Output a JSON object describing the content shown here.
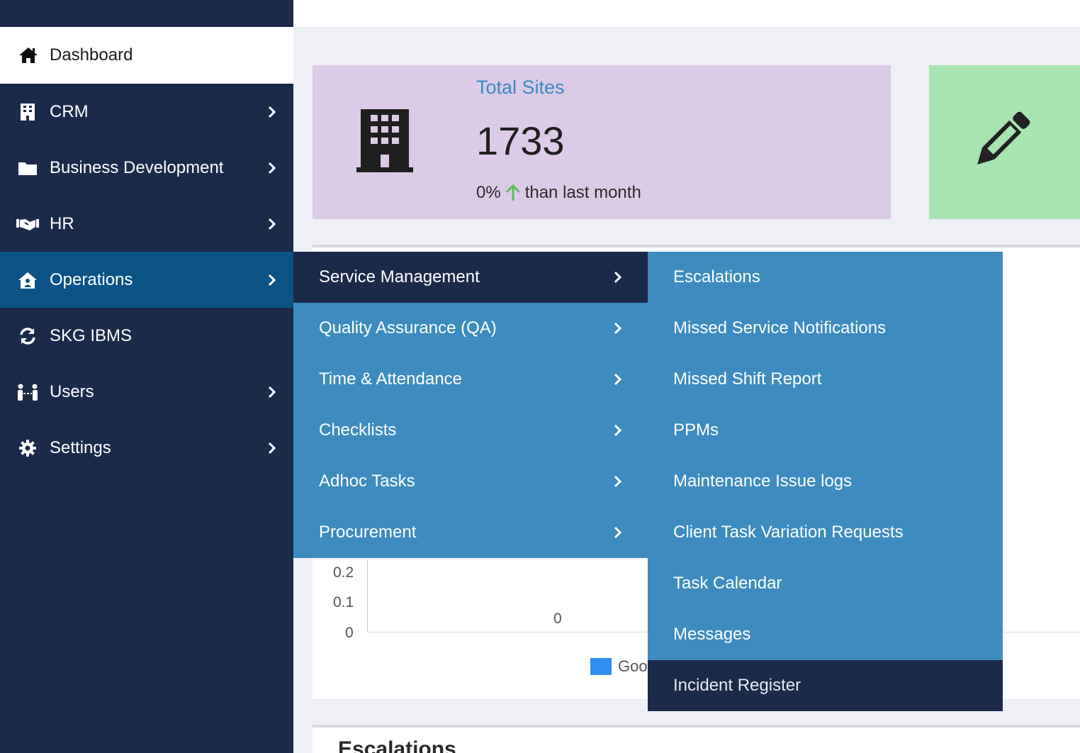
{
  "sidebar": {
    "dashboard": {
      "label": "Dashboard",
      "icon": "home-icon"
    },
    "items": [
      {
        "label": "CRM",
        "icon": "building-icon"
      },
      {
        "label": "Business Development",
        "icon": "folder-icon"
      },
      {
        "label": "HR",
        "icon": "handshake-icon"
      },
      {
        "label": "Operations",
        "icon": "house-user-icon"
      },
      {
        "label": "SKG IBMS",
        "icon": "sync-icon"
      },
      {
        "label": "Users",
        "icon": "users-icon"
      },
      {
        "label": "Settings",
        "icon": "gear-icon"
      }
    ]
  },
  "stats": {
    "sites": {
      "title": "Total Sites",
      "value": "1733",
      "change": "0%",
      "suffix": "than last month"
    }
  },
  "chart": {
    "y_ticks": [
      "0.2",
      "0.1",
      "0"
    ],
    "value_label": "0",
    "legend": "Goo"
  },
  "section2": {
    "title": "Escalations"
  },
  "menu_level1": [
    {
      "label": "Service Management"
    },
    {
      "label": "Quality Assurance (QA)"
    },
    {
      "label": "Time & Attendance"
    },
    {
      "label": "Checklists"
    },
    {
      "label": "Adhoc Tasks"
    },
    {
      "label": "Procurement"
    }
  ],
  "menu_level2": [
    {
      "label": "Escalations"
    },
    {
      "label": "Missed Service Notifications"
    },
    {
      "label": "Missed Shift Report"
    },
    {
      "label": "PPMs"
    },
    {
      "label": "Maintenance Issue logs"
    },
    {
      "label": "Client Task Variation Requests"
    },
    {
      "label": "Task Calendar"
    },
    {
      "label": "Messages"
    },
    {
      "label": "Incident Register"
    }
  ],
  "colors": {
    "sidebar": "#1c2a4a",
    "active": "#0b5285",
    "menu": "#3e8cbf",
    "card_purple": "#dccbe6",
    "card_green": "#a7e4b2",
    "accent": "#3a8ac2"
  }
}
